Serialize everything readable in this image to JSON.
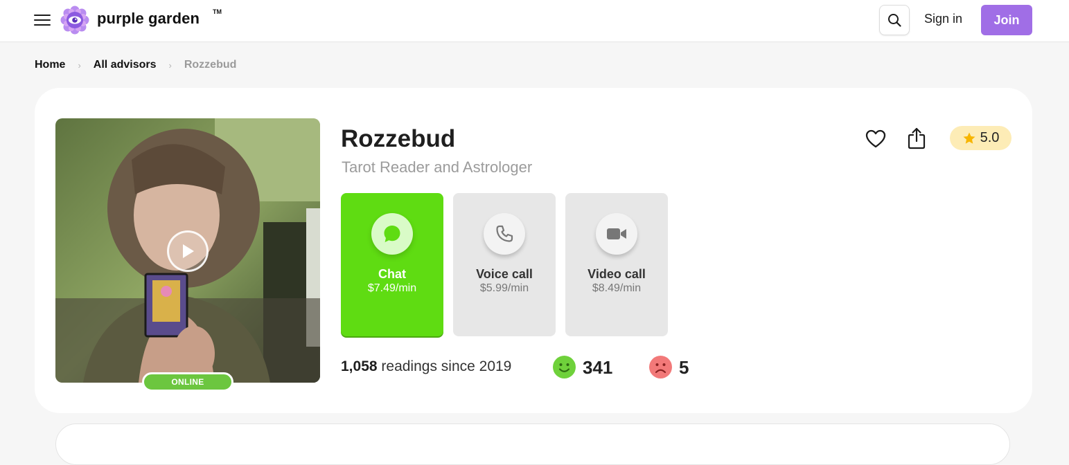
{
  "header": {
    "brand": "purple garden",
    "trademark": "TM",
    "signin_label": "Sign in",
    "join_label": "Join"
  },
  "breadcrumb": {
    "items": [
      "Home",
      "All advisors",
      "Rozzebud"
    ],
    "separator": "›"
  },
  "advisor": {
    "name": "Rozzebud",
    "title": "Tarot Reader and Astrologer",
    "status": "ONLINE",
    "rating": "5.0",
    "readings_count": "1,058",
    "readings_text": " readings since 2019",
    "positive_reviews": "341",
    "negative_reviews": "5"
  },
  "services": [
    {
      "label": "Chat",
      "price": "$7.49/min",
      "icon": "chat-bubble-icon",
      "active": true
    },
    {
      "label": "Voice call",
      "price": "$5.99/min",
      "icon": "phone-icon",
      "active": false
    },
    {
      "label": "Video call",
      "price": "$8.49/min",
      "icon": "video-camera-icon",
      "active": false
    }
  ],
  "colors": {
    "brand_purple": "#a06ee6",
    "chat_green": "#5fdc12",
    "online_green": "#6cc63f",
    "rating_bg": "#fdecb6",
    "happy_green": "#6fd13b",
    "sad_red": "#f27979"
  }
}
